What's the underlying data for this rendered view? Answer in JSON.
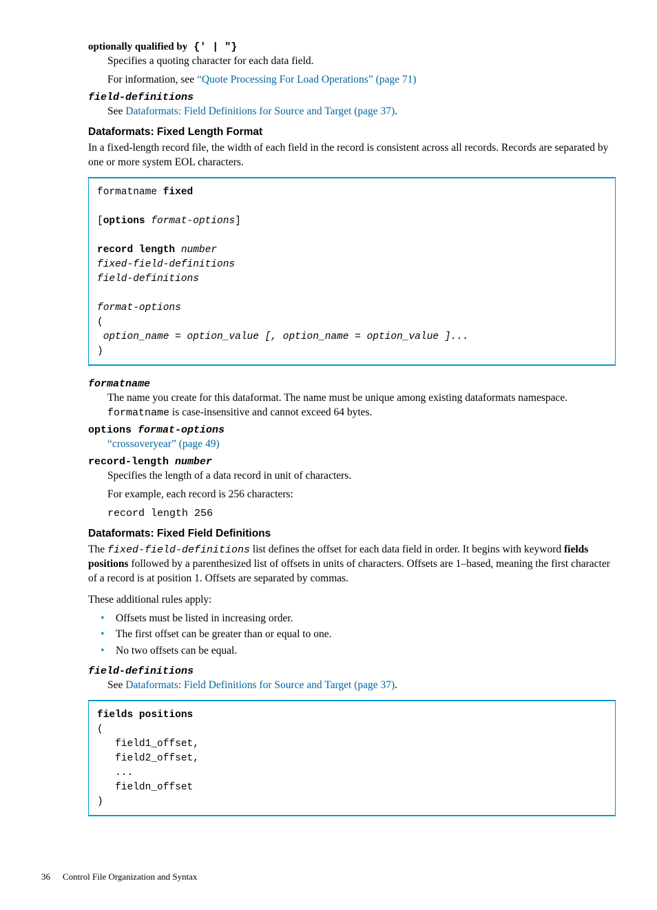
{
  "optQualified": {
    "term_prefix": "optionally qualified by",
    "term_code": " {' | \"}",
    "desc1": "Specifies a quoting character for each data field.",
    "desc2_pre": "For information, see ",
    "desc2_link": "“Quote Processing For Load Operations” (page 71)"
  },
  "fieldDefs1": {
    "term": "field-definitions",
    "desc_pre": "See ",
    "desc_link": "Dataformats: Field Definitions for Source and Target (page 37)",
    "desc_post": "."
  },
  "sec1_heading": "Dataformats: Fixed Length Format",
  "sec1_intro": "In a fixed-length record file, the width of each field in the record is consistent across all records. Records are separated by one or more system EOL characters.",
  "codebox1_l1a": "formatname ",
  "codebox1_l1b": "fixed",
  "codebox1_l2a": "[",
  "codebox1_l2b": "options",
  "codebox1_l2c": " format-options",
  "codebox1_l2d": "]",
  "codebox1_l3a": "record length",
  "codebox1_l3b": " number",
  "codebox1_l4": "fixed-field-definitions",
  "codebox1_l5": "field-definitions",
  "codebox1_l6": "format-options",
  "codebox1_l7": "(",
  "codebox1_l8": " option_name = option_value [, option_name = option_value ]...",
  "codebox1_l9": ")",
  "formatname": {
    "term": "formatname",
    "desc_a": "The name you create for this dataformat. The name must be unique among existing dataformats namespace. ",
    "desc_code": "formatname",
    "desc_b": " is case-insensitive and cannot exceed 64 bytes."
  },
  "optionsFO": {
    "term_bold": "options",
    "term_italic": " format-options",
    "link": "“crossoveryear” (page 49)"
  },
  "recordLen": {
    "term_bold": "record-length",
    "term_italic": " number",
    "desc1": "Specifies the length of a data record in unit of characters.",
    "desc2": "For example, each record is 256 characters:",
    "code": "record length 256"
  },
  "sec2_heading": "Dataformats: Fixed Field Definitions",
  "sec2_para_a": "The ",
  "sec2_para_code": "fixed-field-definitions",
  "sec2_para_b": " list defines the offset for each data field in order. It begins with keyword ",
  "sec2_para_bold": "fields positions",
  "sec2_para_c": " followed by a parenthesized list of offsets in units of characters. Offsets are 1–based, meaning the first character of a record is at position 1. Offsets are separated by commas.",
  "rules_intro": "These additional rules apply:",
  "bullets": {
    "b1": "Offsets must be listed in increasing order.",
    "b2": "The first offset can be greater than or equal to one.",
    "b3": "No two offsets can be equal."
  },
  "fieldDefs2": {
    "term": "field-definitions",
    "desc_pre": "See ",
    "desc_link": "Dataformats: Field Definitions for Source and Target (page 37)",
    "desc_post": "."
  },
  "codebox2_l1": "fields positions",
  "codebox2_l2": "(",
  "codebox2_l3": "   field1_offset,",
  "codebox2_l4": "   field2_offset,",
  "codebox2_l5": "   ...",
  "codebox2_l6": "   fieldn_offset",
  "codebox2_l7": ")",
  "footer": {
    "pagenum": "36",
    "title": "Control File Organization and Syntax"
  }
}
